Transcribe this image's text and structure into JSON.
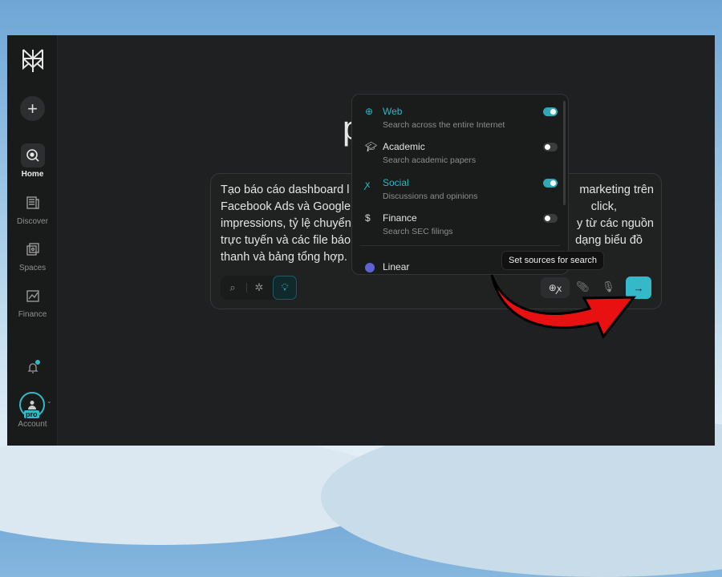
{
  "sidebar": {
    "items": [
      {
        "label": "Home",
        "icon": "search-circle-icon",
        "active": true
      },
      {
        "label": "Discover",
        "icon": "newspaper-icon"
      },
      {
        "label": "Spaces",
        "icon": "spaces-icon"
      },
      {
        "label": "Finance",
        "icon": "chart-icon"
      }
    ],
    "account": {
      "label": "Account",
      "badge": "pro"
    }
  },
  "main": {
    "logo_text": "perplexity",
    "query_lines": [
      [
        "Tạo báo cáo dashboard l",
        "marketing trên"
      ],
      [
        "Facebook Ads và Google",
        "click,"
      ],
      [
        "impressions, tỷ lệ chuyển",
        "y từ các nguồn"
      ],
      [
        "trực tuyến và các file báo",
        "dạng biểu đồ"
      ],
      [
        "thanh và bảng tổng hợp.",
        ""
      ]
    ],
    "tooltip": "Set sources for search"
  },
  "sources": [
    {
      "name": "Web",
      "desc": "Search across the entire Internet",
      "enabled": true,
      "icon": "globe-icon"
    },
    {
      "name": "Academic",
      "desc": "Search academic papers",
      "enabled": false,
      "icon": "graduation-cap-icon"
    },
    {
      "name": "Social",
      "desc": "Discussions and opinions",
      "enabled": true,
      "icon": "network-icon"
    },
    {
      "name": "Finance",
      "desc": "Search SEC filings",
      "enabled": false,
      "icon": "dollar-clipboard-icon"
    },
    {
      "name": "Linear",
      "icon": "linear-logo-icon"
    }
  ],
  "colors": {
    "accent": "#2fb5c7",
    "send_button": "#35b9c9",
    "annotation_arrow": "#e81010"
  }
}
